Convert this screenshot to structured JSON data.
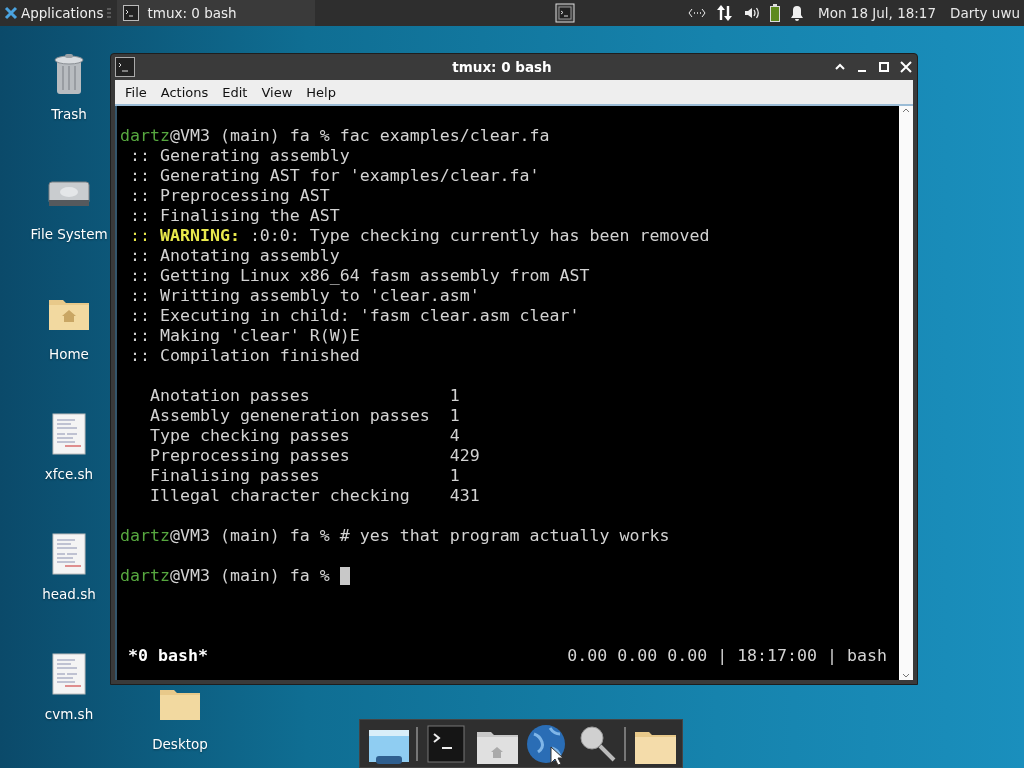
{
  "panel": {
    "apps_menu": "Applications",
    "tasks": [
      {
        "title": "tmux: 0 bash",
        "selected": true
      }
    ],
    "clock": "Mon 18 Jul, 18:17",
    "user": "Darty uwu"
  },
  "desktop_icons": [
    {
      "label": "Trash",
      "kind": "trash"
    },
    {
      "label": "File System",
      "kind": "drive"
    },
    {
      "label": "Home",
      "kind": "home"
    },
    {
      "label": "xfce.sh",
      "kind": "script"
    },
    {
      "label": "head.sh",
      "kind": "script"
    },
    {
      "label": "cvm.sh",
      "kind": "script"
    },
    {
      "label": "Desktop",
      "kind": "folder"
    }
  ],
  "window": {
    "title": "tmux: 0 bash",
    "menu": [
      "File",
      "Actions",
      "Edit",
      "View",
      "Help"
    ],
    "terminal": {
      "lines": [
        {
          "kind": "prompt",
          "user": "dartz",
          "text": "@VM3 (main) fa % fac examples/clear.fa",
          "cursor": false
        },
        {
          "kind": "info",
          "text": ":: Generating assembly"
        },
        {
          "kind": "info",
          "text": ":: Generating AST for 'examples/clear.fa'"
        },
        {
          "kind": "info",
          "text": ":: Preprocessing AST"
        },
        {
          "kind": "info",
          "text": ":: Finalising the AST"
        },
        {
          "kind": "warning",
          "prefix": "::",
          "label": "WARNING:",
          "text": ":0:0: Type checking currently has been removed"
        },
        {
          "kind": "info",
          "text": ":: Anotating assembly"
        },
        {
          "kind": "info",
          "text": ":: Getting Linux x86_64 fasm assembly from AST"
        },
        {
          "kind": "info",
          "text": ":: Writting assembly to 'clear.asm'"
        },
        {
          "kind": "info",
          "text": ":: Executing in child: 'fasm clear.asm clear'"
        },
        {
          "kind": "info",
          "text": ":: Making 'clear' R(W)E"
        },
        {
          "kind": "info",
          "text": ":: Compilation finished"
        },
        {
          "kind": "blank"
        },
        {
          "kind": "stat",
          "name": "Anotation passes",
          "value": "1"
        },
        {
          "kind": "stat",
          "name": "Assembly geneneration passes",
          "value": "1"
        },
        {
          "kind": "stat",
          "name": "Type checking passes",
          "value": "4"
        },
        {
          "kind": "stat",
          "name": "Preprocessing passes",
          "value": "429"
        },
        {
          "kind": "stat",
          "name": "Finalising passes",
          "value": "1"
        },
        {
          "kind": "stat",
          "name": "Illegal character checking",
          "value": "431"
        },
        {
          "kind": "blank"
        },
        {
          "kind": "prompt",
          "user": "dartz",
          "text": "@VM3 (main) fa % # yes that program actually works",
          "cursor": false
        },
        {
          "kind": "blank"
        },
        {
          "kind": "prompt",
          "user": "dartz",
          "text": "@VM3 (main) fa %",
          "cursor": true
        }
      ],
      "status_left": "*0 bash*",
      "status_right": "0.00 0.00 0.00 | 18:17:00 | bash"
    }
  },
  "dock": [
    {
      "kind": "window"
    },
    {
      "kind": "separator"
    },
    {
      "kind": "terminal"
    },
    {
      "kind": "home"
    },
    {
      "kind": "globe"
    },
    {
      "kind": "search"
    },
    {
      "kind": "separator"
    },
    {
      "kind": "folder"
    }
  ]
}
